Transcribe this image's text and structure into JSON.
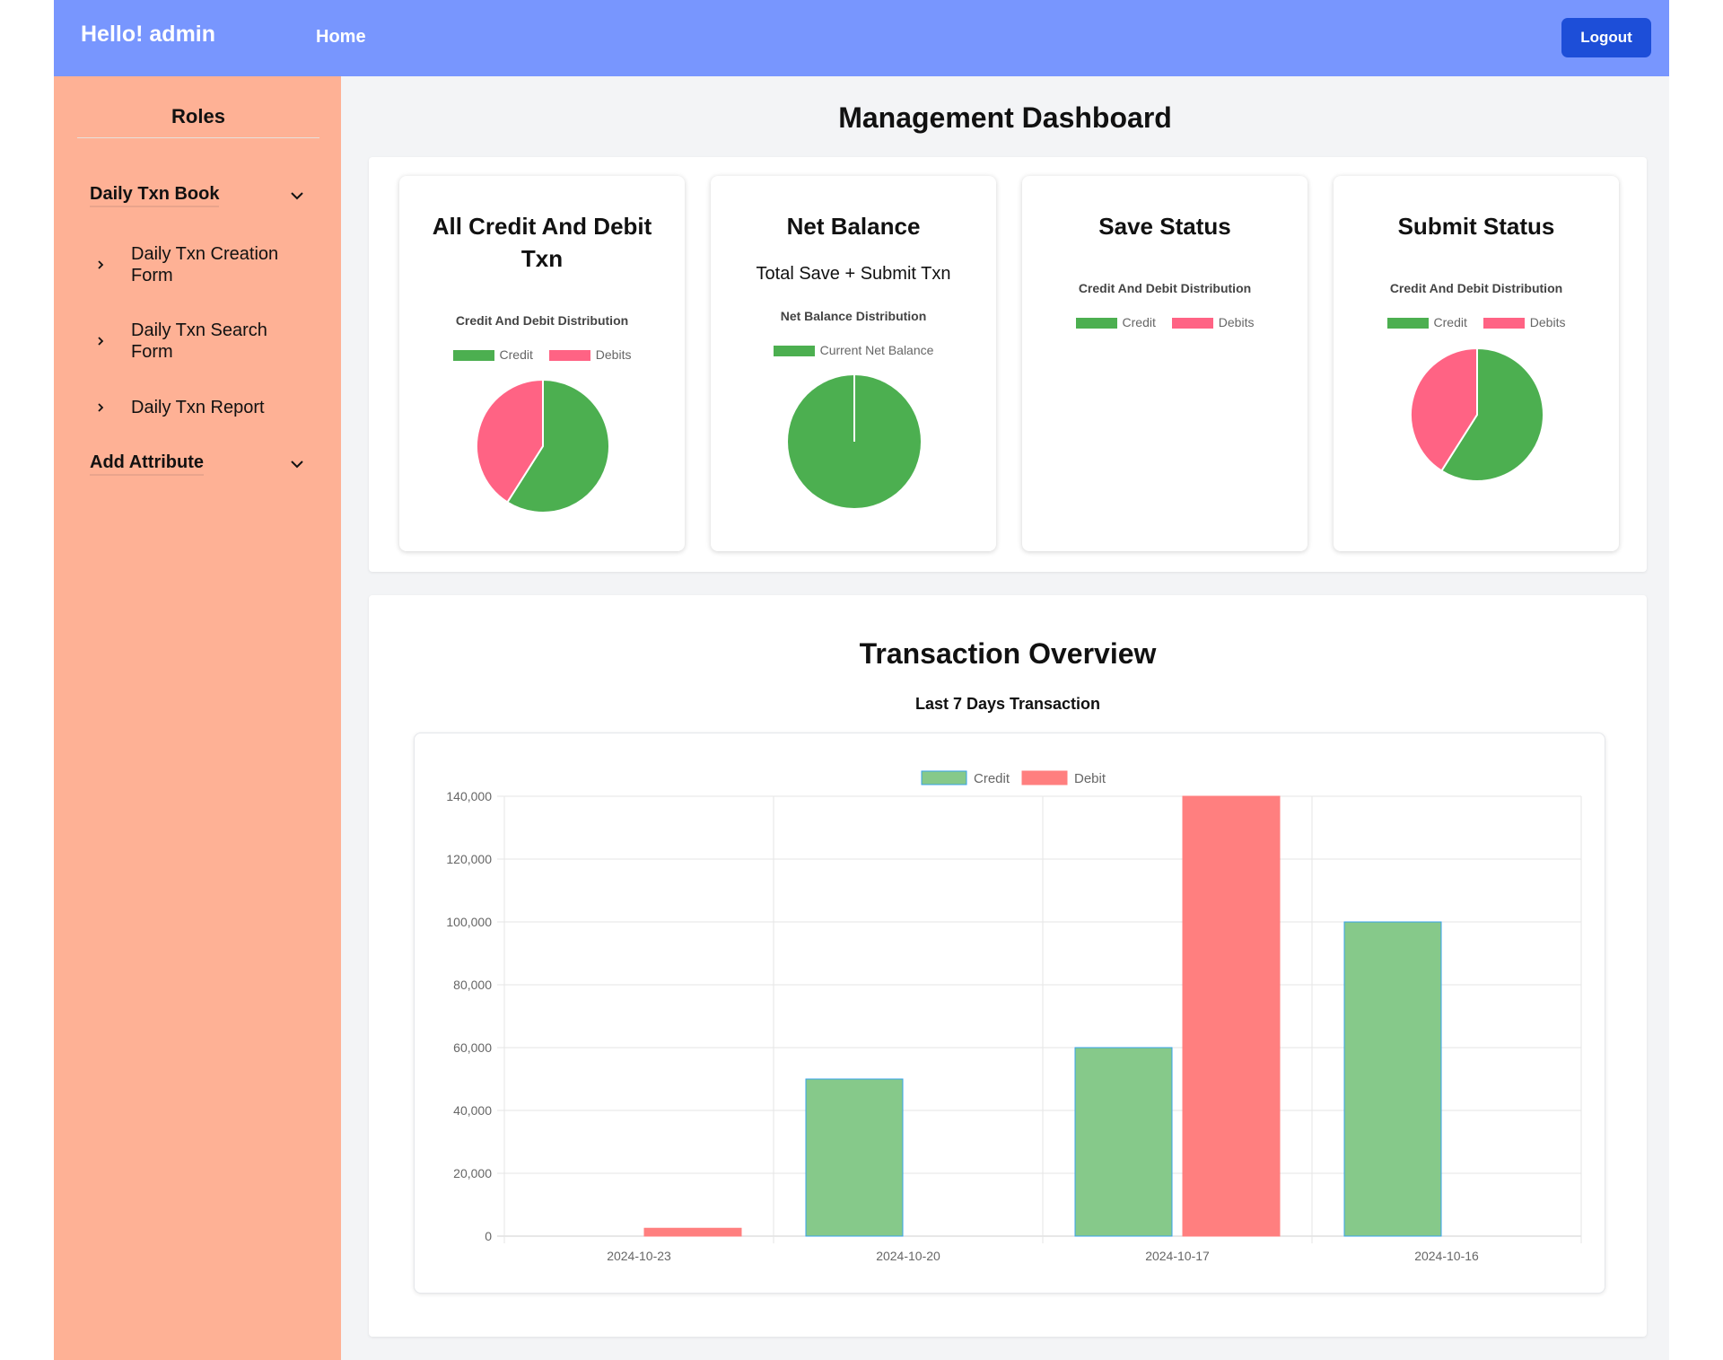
{
  "header": {
    "greeting": "Hello! admin",
    "home_label": "Home",
    "logout_label": "Logout",
    "bg_color": "#7896fe",
    "logout_color": "#1d4ed8"
  },
  "sidebar": {
    "title": "Roles",
    "bg_color": "#feb195",
    "sections": [
      {
        "label": "Daily Txn Book",
        "icon": "chevron-down-icon",
        "items": [
          {
            "label": "Daily Txn Creation Form",
            "icon": "chevron-right-icon"
          },
          {
            "label": "Daily Txn Search Form",
            "icon": "chevron-right-icon"
          },
          {
            "label": "Daily Txn Report",
            "icon": "chevron-right-icon"
          }
        ]
      },
      {
        "label": "Add Attribute",
        "icon": "chevron-down-icon",
        "items": []
      }
    ]
  },
  "main": {
    "title": "Management Dashboard",
    "cards": [
      {
        "title": "All Credit And Debit Txn",
        "subtitle": "",
        "chart_title": "Credit And Debit Distribution",
        "legend": [
          "Credit",
          "Debits"
        ]
      },
      {
        "title": "Net Balance",
        "subtitle": "Total Save + Submit Txn",
        "chart_title": "Net Balance Distribution",
        "legend": [
          "Current Net Balance"
        ]
      },
      {
        "title": "Save Status",
        "subtitle": "",
        "chart_title": "Credit And Debit Distribution",
        "legend": [
          "Credit",
          "Debits"
        ]
      },
      {
        "title": "Submit Status",
        "subtitle": "",
        "chart_title": "Credit And Debit Distribution",
        "legend": [
          "Credit",
          "Debits"
        ]
      }
    ],
    "overview": {
      "title": "Transaction Overview",
      "subtitle": "Last 7 Days Transaction"
    }
  },
  "chart_data": [
    {
      "type": "pie",
      "title": "Credit And Debit Distribution",
      "labels": [
        "Credit",
        "Debits"
      ],
      "values": [
        59,
        41
      ],
      "colors": [
        "#4caf50",
        "#ff6384"
      ]
    },
    {
      "type": "pie",
      "title": "Net Balance Distribution",
      "labels": [
        "Current Net Balance"
      ],
      "values": [
        100
      ],
      "colors": [
        "#4caf50"
      ]
    },
    {
      "type": "pie",
      "title": "Credit And Debit Distribution",
      "labels": [
        "Credit",
        "Debits"
      ],
      "values": [],
      "colors": [
        "#4caf50",
        "#ff6384"
      ]
    },
    {
      "type": "pie",
      "title": "Credit And Debit Distribution",
      "labels": [
        "Credit",
        "Debits"
      ],
      "values": [
        59,
        41
      ],
      "colors": [
        "#4caf50",
        "#ff6384"
      ]
    },
    {
      "type": "bar",
      "title": "Last 7 Days Transaction",
      "categories": [
        "2024-10-23",
        "2024-10-20",
        "2024-10-17",
        "2024-10-16"
      ],
      "series": [
        {
          "name": "Credit",
          "values": [
            0,
            50000,
            60000,
            100000
          ],
          "color": "#86c98a",
          "border": "#36a2eb"
        },
        {
          "name": "Debit",
          "values": [
            2500,
            0,
            140000,
            0
          ],
          "color": "#ff7f7f",
          "border": "#ff7f7f"
        }
      ],
      "yticks": [
        0,
        20000,
        40000,
        60000,
        80000,
        100000,
        120000,
        140000
      ],
      "ylim": [
        0,
        140000
      ],
      "legend": "top",
      "grid": true
    }
  ]
}
